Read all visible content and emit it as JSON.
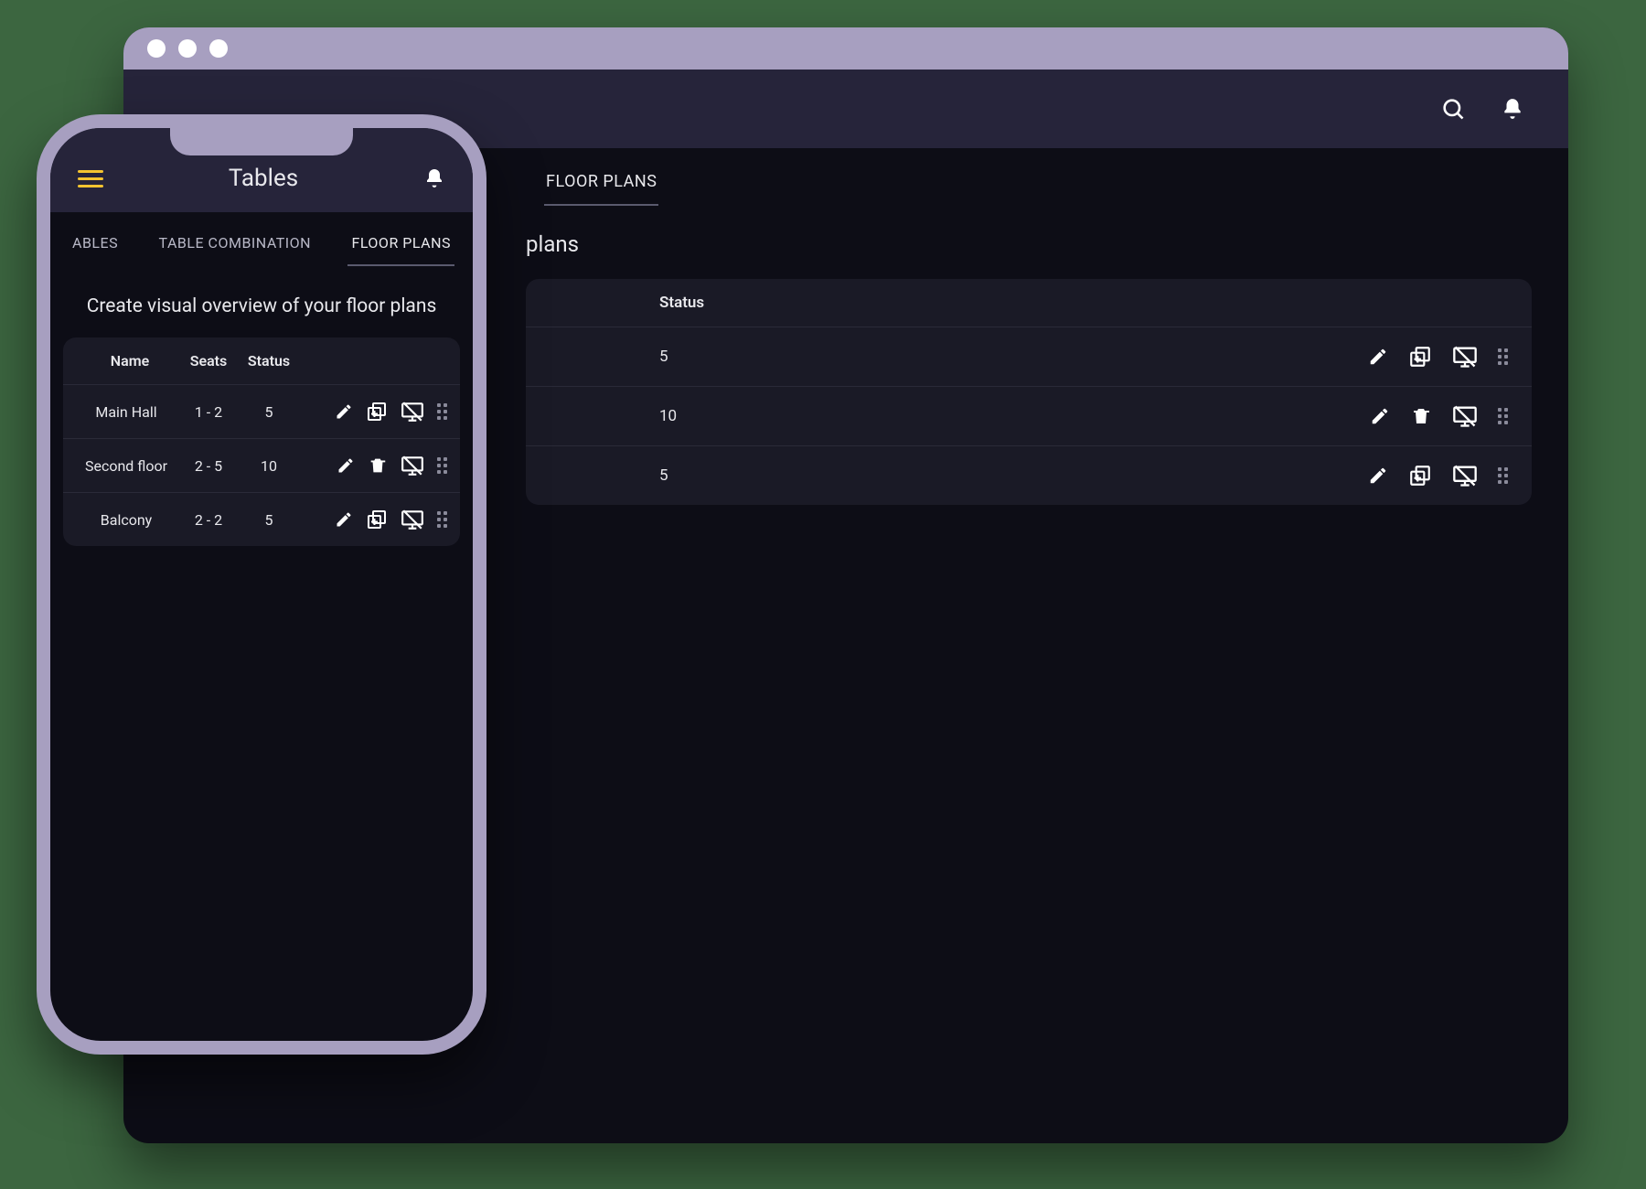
{
  "desktop": {
    "tabs": {
      "floor_plans": "FLOOR PLANS"
    },
    "subtitle_fragment": "plans",
    "columns": {
      "status": "Status"
    },
    "rows": [
      {
        "status": "5",
        "action_variant": "duplicate"
      },
      {
        "status": "10",
        "action_variant": "delete"
      },
      {
        "status": "5",
        "action_variant": "duplicate"
      }
    ]
  },
  "phone": {
    "title": "Tables",
    "tabs": {
      "tables_partial": "ABLES",
      "table_combination": "TABLE COMBINATION",
      "floor_plans": "FLOOR PLANS"
    },
    "subtitle": "Create visual overview of your floor plans",
    "columns": {
      "name": "Name",
      "seats": "Seats",
      "status": "Status"
    },
    "rows": [
      {
        "name": "Main Hall",
        "seats": "1 - 2",
        "status": "5",
        "action_variant": "duplicate"
      },
      {
        "name": "Second floor",
        "seats": "2 - 5",
        "status": "10",
        "action_variant": "delete"
      },
      {
        "name": "Balcony",
        "seats": "2 - 2",
        "status": "5",
        "action_variant": "duplicate"
      }
    ]
  }
}
